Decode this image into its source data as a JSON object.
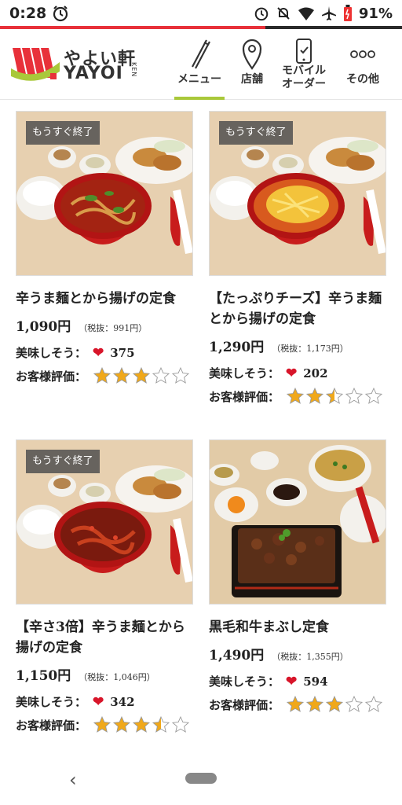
{
  "status": {
    "time": "0:28",
    "battery": "91%"
  },
  "header": {
    "logo_jp": "やよい軒",
    "logo_en": "YAYOI",
    "logo_ken": "KEN",
    "nav": [
      {
        "label": "メニュー",
        "icon": "chopsticks-icon"
      },
      {
        "label": "店舗",
        "icon": "location-pin-icon"
      },
      {
        "label": "モバイル\nオーダー",
        "icon": "phone-check-icon"
      },
      {
        "label": "その他",
        "icon": "more-dots-icon"
      }
    ]
  },
  "products": [
    {
      "badge": "もうすぐ終了",
      "name": "辛うま麺とから揚げの定食",
      "price": "1,090円",
      "tax": "（税抜：991円）",
      "like_label": "美味しそう：",
      "likes": "375",
      "review_label": "お客様評価：",
      "rating": 3
    },
    {
      "badge": "もうすぐ終了",
      "name": "【たっぷりチーズ】辛うま麺とから揚げの定食",
      "price": "1,290円",
      "tax": "（税抜：1,173円）",
      "like_label": "美味しそう：",
      "likes": "202",
      "review_label": "お客様評価：",
      "rating": 2.5
    },
    {
      "badge": "もうすぐ終了",
      "name": "【辛さ3倍】辛うま麺とから揚げの定食",
      "price": "1,150円",
      "tax": "（税抜：1,046円）",
      "like_label": "美味しそう：",
      "likes": "342",
      "review_label": "お客様評価：",
      "rating": 3.5
    },
    {
      "badge": "",
      "name": "黒毛和牛まぶし定食",
      "price": "1,490円",
      "tax": "（税抜：1,355円）",
      "like_label": "美味しそう：",
      "likes": "594",
      "review_label": "お客様評価：",
      "rating": 3
    }
  ],
  "colors": {
    "accent_green": "#a9c83a",
    "heart_red": "#d8152a",
    "star_gold": "#f0a81a"
  }
}
